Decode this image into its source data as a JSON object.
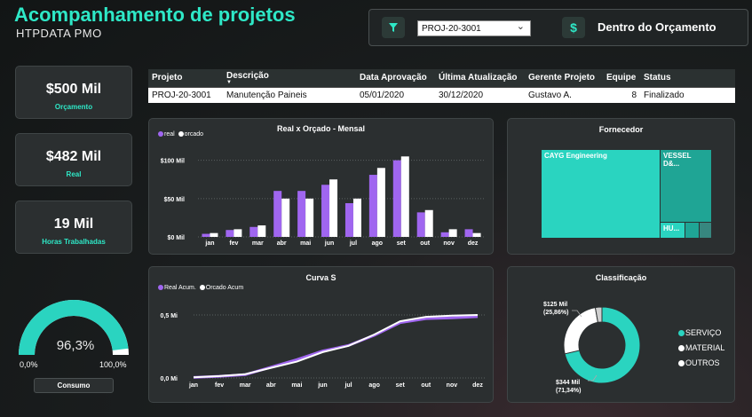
{
  "header": {
    "title": "Acompanhamento de projetos",
    "subtitle": "HTPDATA  PMO"
  },
  "filter": {
    "icon": "filter-icon",
    "selected_project": "PROJ-20-3001",
    "status_icon": "dollar-icon",
    "status_text": "Dentro do Orçamento"
  },
  "kpis": [
    {
      "value": "$500 Mil",
      "label": "Orçamento"
    },
    {
      "value": "$482 Mil",
      "label": "Real"
    },
    {
      "value": "19 Mil",
      "label": "Horas Trabalhadas"
    }
  ],
  "table": {
    "columns": [
      "Projeto",
      "Descrição",
      "Data Aprovação",
      "Última Atualização",
      "Gerente Projeto",
      "Equipe",
      "Status"
    ],
    "rows": [
      [
        "PROJ-20-3001",
        "Manutenção Paineis",
        "05/01/2020",
        "30/12/2020",
        "Gustavo A.",
        "8",
        "Finalizado"
      ]
    ]
  },
  "gauge": {
    "percent": 0.963,
    "value_label": "96,3%",
    "min_label": "0,0%",
    "max_label": "100,0%",
    "button": "Consumo"
  },
  "fornecedor": {
    "title": "Fornecedor",
    "cells": [
      {
        "label": "CAYG Engineering",
        "color": "#2ad4c0"
      },
      {
        "label": "VESSEL D&...",
        "color": "#1fa595"
      },
      {
        "label": "HU...",
        "color": "#2ad4c0"
      }
    ]
  },
  "classificacao": {
    "title": "Classificação",
    "label_small": "$125 Mil",
    "label_small_pct": "(25,86%)",
    "label_big": "$344 Mil",
    "label_big_pct": "(71,34%)",
    "legend": [
      "SERVIÇO",
      "MATERIAL",
      "OUTROS"
    ]
  },
  "colors": {
    "accent": "#2ee8c7",
    "real": "#a066f0",
    "orcado": "#ffffff",
    "teal": "#2ad4c0"
  },
  "chart_data": [
    {
      "type": "bar",
      "title": "Real x Orçado  - Mensal",
      "categories": [
        "jan",
        "fev",
        "mar",
        "abr",
        "mai",
        "jun",
        "jul",
        "ago",
        "set",
        "out",
        "nov",
        "dez"
      ],
      "yticks": [
        "$0 Mil",
        "$50 Mil",
        "$100 Mil"
      ],
      "ylim": [
        0,
        110
      ],
      "series": [
        {
          "name": "real",
          "color": "#a066f0",
          "values": [
            4,
            9,
            13,
            60,
            60,
            68,
            44,
            81,
            100,
            32,
            6,
            10
          ]
        },
        {
          "name": "orcado",
          "color": "#ffffff",
          "values": [
            5,
            10,
            15,
            50,
            50,
            75,
            50,
            90,
            105,
            35,
            10,
            5
          ]
        }
      ]
    },
    {
      "type": "line",
      "title": "Curva S",
      "categories": [
        "jan",
        "fev",
        "mar",
        "abr",
        "mai",
        "jun",
        "jul",
        "ago",
        "set",
        "out",
        "nov",
        "dez"
      ],
      "yticks": [
        "0,0 Mi",
        "0,5 Mi"
      ],
      "ylim": [
        0,
        0.5
      ],
      "series": [
        {
          "name": "Real Acum.",
          "color": "#a066f0",
          "values": [
            0.004,
            0.013,
            0.026,
            0.086,
            0.146,
            0.214,
            0.258,
            0.339,
            0.439,
            0.471,
            0.477,
            0.487
          ]
        },
        {
          "name": "Orcado Acum",
          "color": "#ffffff",
          "values": [
            0.005,
            0.015,
            0.03,
            0.08,
            0.13,
            0.205,
            0.255,
            0.345,
            0.45,
            0.485,
            0.495,
            0.5
          ]
        }
      ]
    },
    {
      "type": "pie",
      "title": "Classificação",
      "categories": [
        "SERVIÇO",
        "MATERIAL",
        "OUTROS"
      ],
      "values": [
        71.34,
        25.86,
        2.8
      ],
      "colors": [
        "#2ad4c0",
        "#ffffff",
        "#cfcfcf"
      ]
    }
  ]
}
